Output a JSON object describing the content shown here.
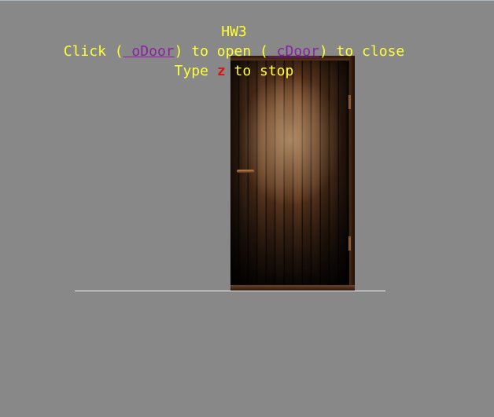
{
  "header": {
    "title": "HW3",
    "line1": {
      "before": "Click (",
      "open_link": " oDoor",
      "middle": ") to open (",
      "close_link": " cDoor",
      "after": ") to close"
    },
    "line2": {
      "before": "Type ",
      "key": "z",
      "after": " to stop"
    }
  },
  "colors": {
    "background": "#888888",
    "text": "#ffff33",
    "link": "#8a22a8",
    "key": "#e01010",
    "floor": "#f2f2f2"
  },
  "scene": {
    "object": "door-icon"
  }
}
